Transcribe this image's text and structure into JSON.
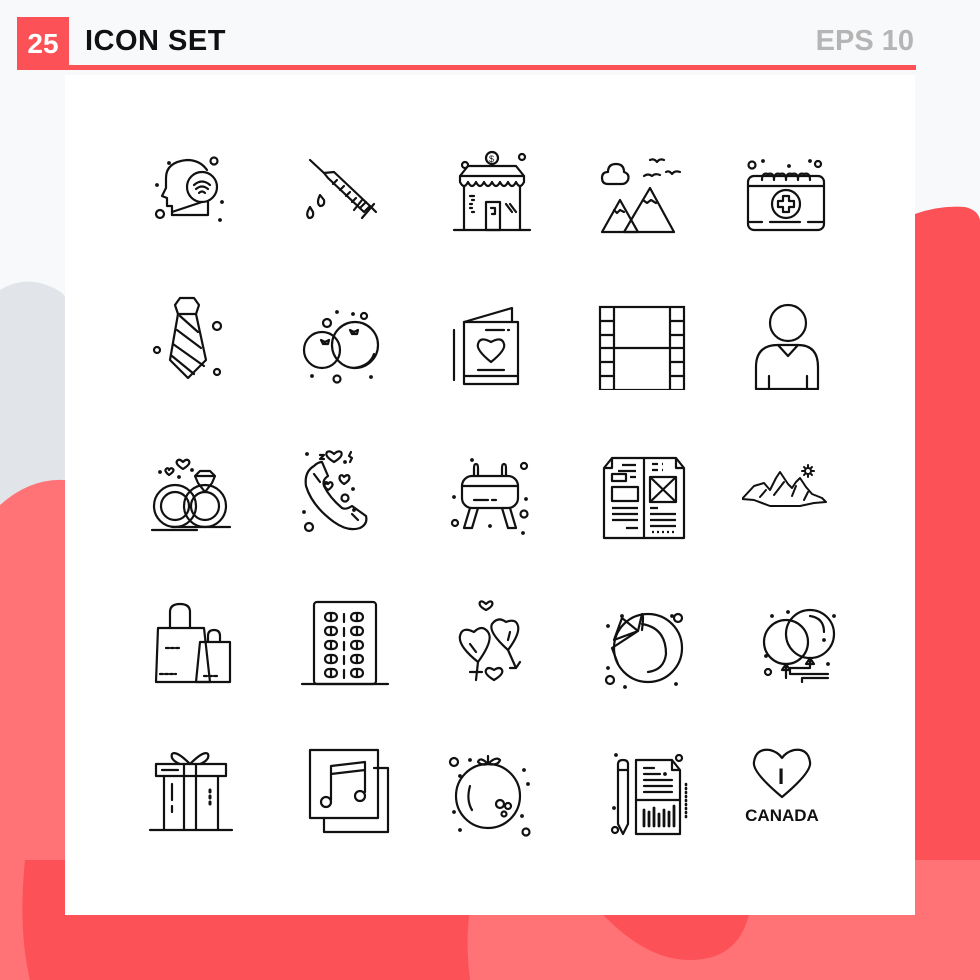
{
  "header": {
    "count": "25",
    "title": "ICON SET",
    "format": "EPS 10"
  },
  "colors": {
    "accent": "#fb5157",
    "accent_light": "#ff7276",
    "gray_blob": "#e1e5e9",
    "background": "#f8f9fb",
    "panel": "#ffffff",
    "icon_stroke": "#111111",
    "format_text": "#b5b5b5"
  },
  "icons": [
    {
      "name": "head-wifi-icon",
      "label": "mind wifi"
    },
    {
      "name": "syringe-icon",
      "label": "injection"
    },
    {
      "name": "shop-icon",
      "label": "store"
    },
    {
      "name": "mountains-birds-icon",
      "label": "landscape"
    },
    {
      "name": "medical-calendar-icon",
      "label": "calendar plus"
    },
    {
      "name": "necktie-icon",
      "label": "tie"
    },
    {
      "name": "fruits-icon",
      "label": "oranges"
    },
    {
      "name": "love-card-icon",
      "label": "greeting card"
    },
    {
      "name": "film-strip-icon",
      "label": "film"
    },
    {
      "name": "user-icon",
      "label": "person"
    },
    {
      "name": "rings-icon",
      "label": "wedding rings"
    },
    {
      "name": "love-call-icon",
      "label": "phone hearts"
    },
    {
      "name": "vaulting-horse-icon",
      "label": "pommel horse"
    },
    {
      "name": "newspaper-icon",
      "label": "news layout"
    },
    {
      "name": "mountain-sun-icon",
      "label": "hills"
    },
    {
      "name": "shopping-bags-icon",
      "label": "bags"
    },
    {
      "name": "pills-blister-icon",
      "label": "tablets"
    },
    {
      "name": "gender-hearts-icon",
      "label": "love"
    },
    {
      "name": "pie-chart-icon",
      "label": "chart"
    },
    {
      "name": "balloons-icon",
      "label": "balloons"
    },
    {
      "name": "gift-icon",
      "label": "present"
    },
    {
      "name": "music-album-icon",
      "label": "music note"
    },
    {
      "name": "orange-fruit-icon",
      "label": "fruit"
    },
    {
      "name": "report-icon",
      "label": "document chart"
    },
    {
      "name": "i-love-canada-icon",
      "label": "heart",
      "text_i": "I",
      "text": "CANADA"
    }
  ]
}
